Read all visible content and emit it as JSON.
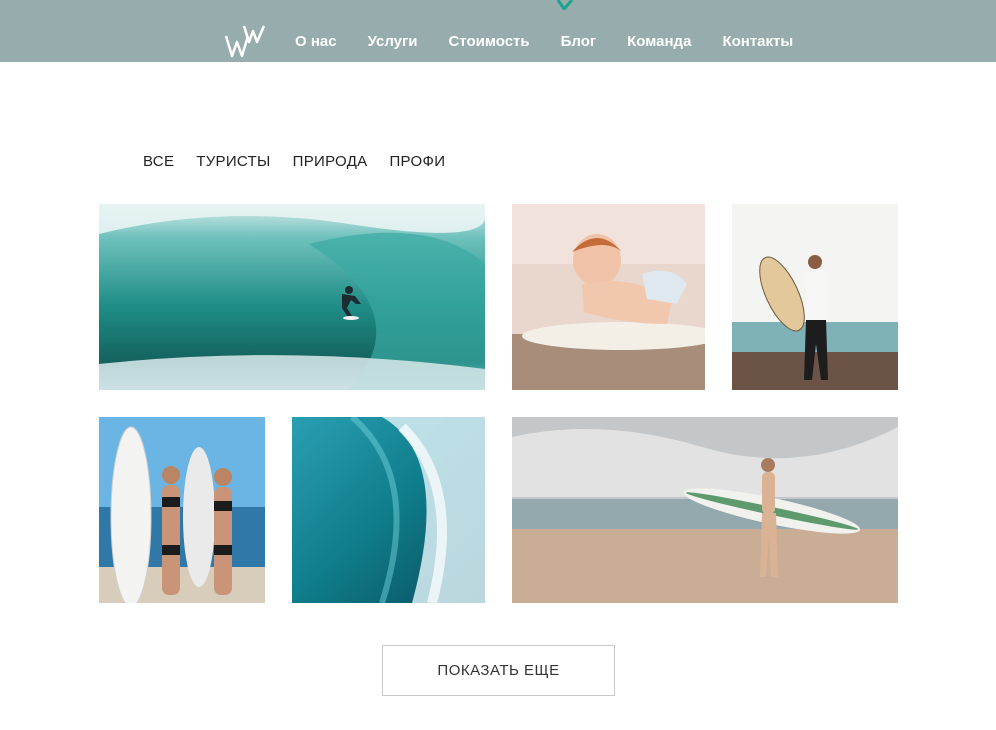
{
  "header": {
    "logo_icon": "ww-logo-icon",
    "nav": [
      {
        "label": "О нас"
      },
      {
        "label": "Услуги"
      },
      {
        "label": "Стоимость"
      },
      {
        "label": "Блог"
      },
      {
        "label": "Команда"
      },
      {
        "label": "Контакты"
      }
    ],
    "colors": {
      "bar": "#97adad",
      "accent": "#1aa58e"
    }
  },
  "filters": [
    {
      "label": "ВСЕ"
    },
    {
      "label": "ТУРИСТЫ"
    },
    {
      "label": "ПРИРОДА"
    },
    {
      "label": "ПРОФИ"
    }
  ],
  "gallery": [
    {
      "subject": "surfer-in-wave-barrel"
    },
    {
      "subject": "baby-on-surfboard"
    },
    {
      "subject": "man-with-surfboard"
    },
    {
      "subject": "two-women-with-surfboards"
    },
    {
      "subject": "wave-close-up"
    },
    {
      "subject": "woman-with-surfboard-on-beach"
    }
  ],
  "show_more": {
    "label": "ПОКАЗАТЬ ЕЩЕ"
  }
}
